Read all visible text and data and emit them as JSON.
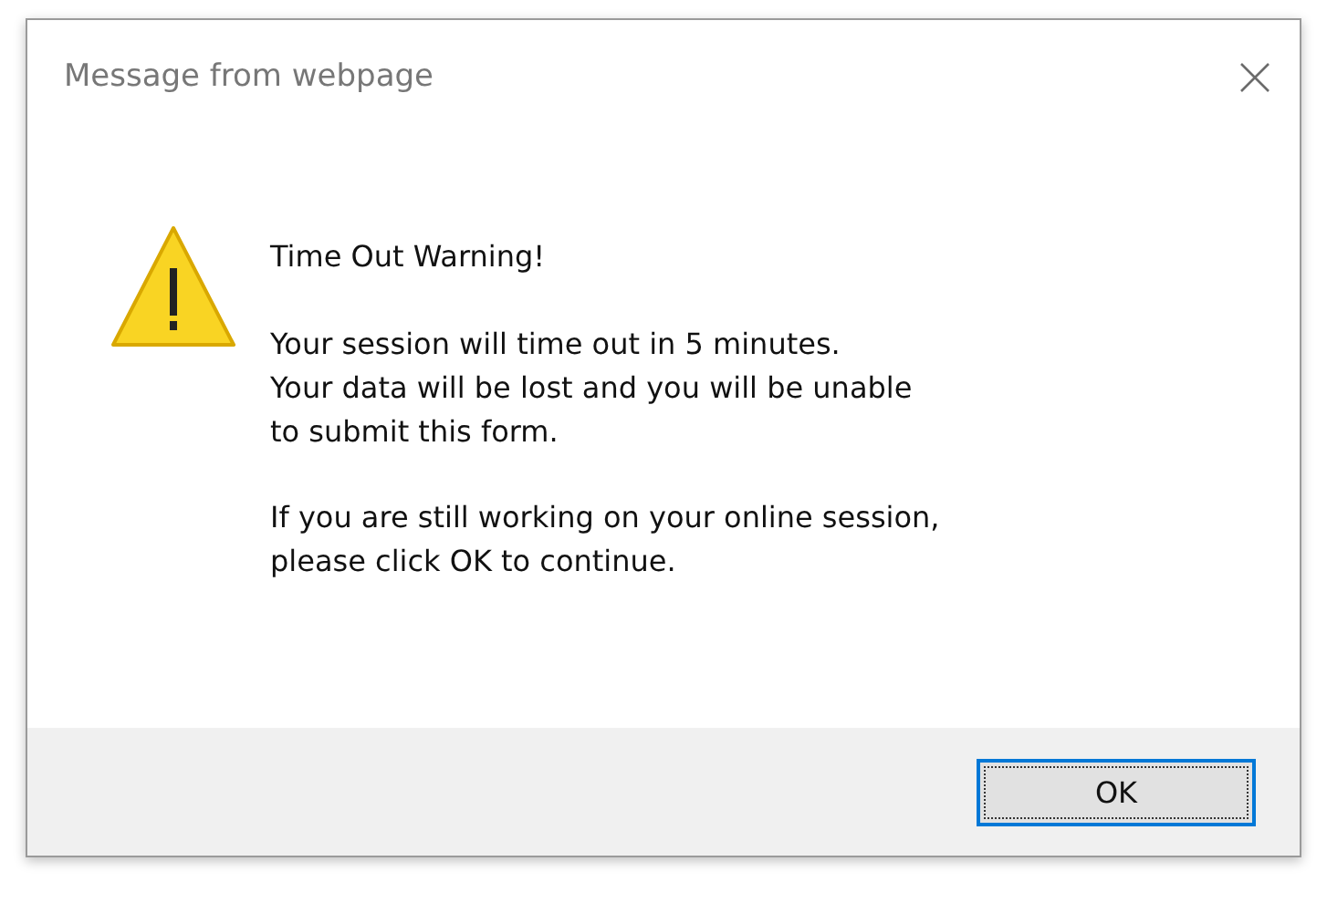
{
  "window": {
    "title": "Message from webpage"
  },
  "message": {
    "heading": "Time Out Warning!",
    "paragraphs": [
      [
        "Your session will time out in 5 minutes.",
        "Your data will be lost and you will be unable",
        "to submit this form."
      ],
      [
        "If you are still working on your online session,",
        "please click OK to continue."
      ]
    ]
  },
  "buttons": [
    {
      "label": "OK",
      "default": true
    }
  ]
}
